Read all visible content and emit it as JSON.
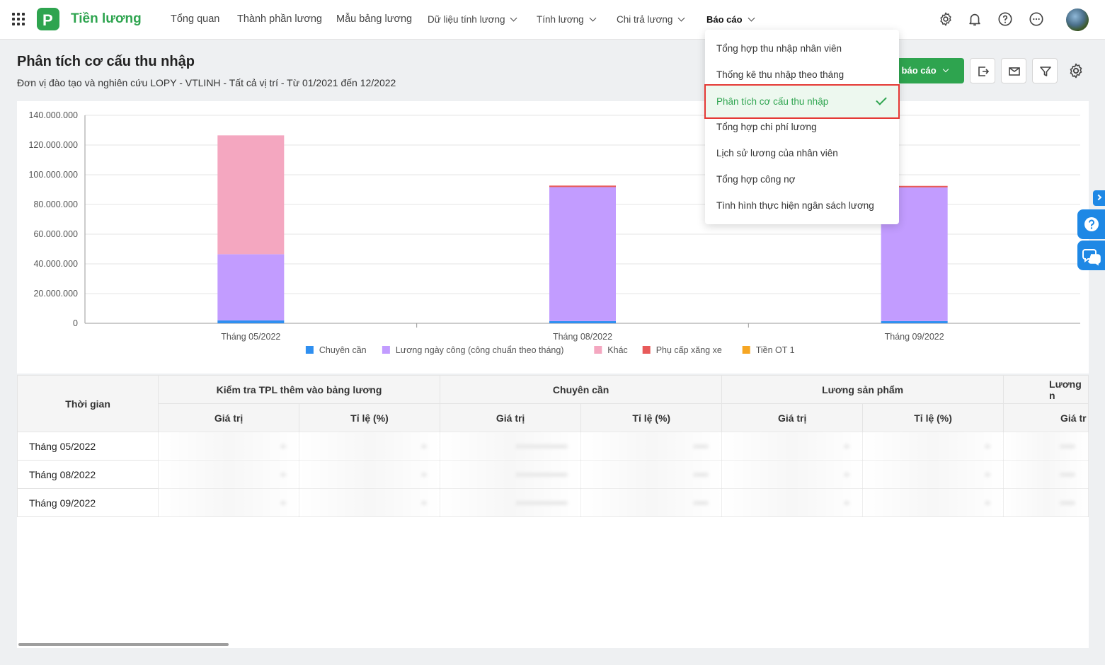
{
  "app": {
    "title": "Tiền lương",
    "logo_letter": "P"
  },
  "nav": {
    "items": [
      {
        "label": "Tổng quan",
        "dropdown": false
      },
      {
        "label": "Thành phần lương",
        "dropdown": false
      },
      {
        "label": "Mẫu bảng lương",
        "dropdown": false
      },
      {
        "label": "Dữ liệu tính lương",
        "dropdown": true
      },
      {
        "label": "Tính lương",
        "dropdown": true
      },
      {
        "label": "Chi trả lương",
        "dropdown": true
      },
      {
        "label": "Báo cáo",
        "dropdown": true,
        "active": true
      }
    ]
  },
  "header_icons": [
    "gear-icon",
    "bell-icon",
    "help-icon",
    "more-icon",
    "avatar"
  ],
  "page": {
    "title": "Phân tích cơ cấu thu nhập",
    "subtitle": "Đơn vị đào tạo và nghiên cứu LOPY - VTLINH - Tất cả vị trí - Từ 01/2021 đến 12/2022",
    "report_button": "n báo cáo"
  },
  "report_menu": {
    "items": [
      {
        "label": "Tổng hợp thu nhập nhân viên",
        "selected": false
      },
      {
        "label": "Thống kê thu nhập theo tháng",
        "selected": false
      },
      {
        "label": "Phân tích cơ cấu thu nhập",
        "selected": true
      },
      {
        "label": "Tổng hợp chi phí lương",
        "selected": false
      },
      {
        "label": "Lịch sử lương của nhân viên",
        "selected": false
      },
      {
        "label": "Tổng hợp công nợ",
        "selected": false
      },
      {
        "label": "Tình hình thực hiện ngân sách lương",
        "selected": false
      }
    ]
  },
  "chart_data": {
    "type": "bar",
    "stacked": true,
    "categories": [
      "Tháng 05/2022",
      "Tháng 08/2022",
      "Tháng 09/2022"
    ],
    "series": [
      {
        "name": "Chuyên cần",
        "color": "#2f8ff0",
        "values": [
          2000000,
          1500000,
          1500000
        ]
      },
      {
        "name": "Lương ngày công (công chuẩn theo tháng)",
        "color": "#c29cff",
        "values": [
          44500000,
          90200000,
          90000000
        ]
      },
      {
        "name": "Khác",
        "color": "#f4a7c0",
        "values": [
          80000000,
          0,
          0
        ]
      },
      {
        "name": "Phụ cấp xăng xe",
        "color": "#e85a5a",
        "values": [
          0,
          1000000,
          1000000
        ]
      },
      {
        "name": "Tiền OT 1",
        "color": "#f6a623",
        "values": [
          0,
          0,
          0
        ]
      }
    ],
    "y_ticks": [
      "0",
      "20.000.000",
      "40.000.000",
      "60.000.000",
      "80.000.000",
      "100.000.000",
      "120.000.000",
      "140.000.000"
    ],
    "ylim": [
      0,
      140000000
    ],
    "grid": true,
    "legend_position": "bottom"
  },
  "table": {
    "time_header": "Thời gian",
    "groups": [
      "Kiểm tra TPL thêm vào bảng lương",
      "Chuyên cần",
      "Lương sản phẩm",
      "Lương n"
    ],
    "sub_headers": [
      "Giá trị",
      "Tỉ lệ (%)",
      "Giá trị",
      "Tỉ lệ (%)",
      "Giá trị",
      "Tỉ lệ (%)",
      "Giá tr"
    ],
    "rows": [
      {
        "time": "Tháng 05/2022"
      },
      {
        "time": "Tháng 08/2022"
      },
      {
        "time": "Tháng 09/2022"
      }
    ]
  },
  "colors": {
    "accent": "#2ea44f",
    "highlight_border": "#e53935",
    "side_buttons": "#1e88e5"
  }
}
